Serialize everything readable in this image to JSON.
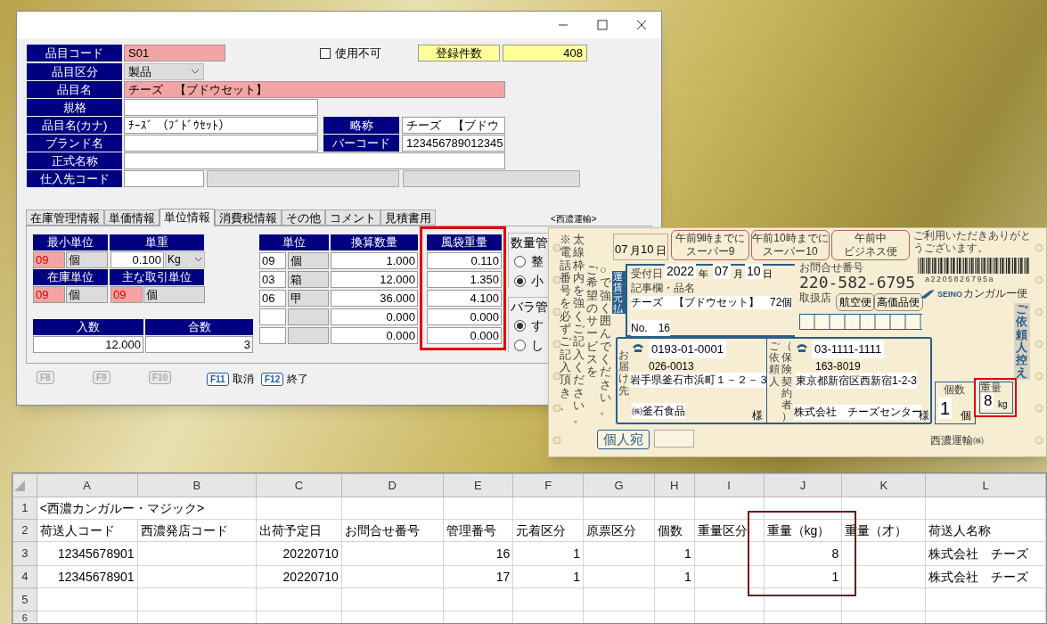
{
  "item_form": {
    "item_code": {
      "label": "品目コード",
      "value": "S01"
    },
    "unusable": {
      "label": "使用不可",
      "checked": false
    },
    "record_count": {
      "label": "登録件数",
      "value": "408"
    },
    "item_category": {
      "label": "品目区分",
      "value": "製品"
    },
    "item_name": {
      "label": "品目名",
      "value": "チーズ　【ブドウセット】"
    },
    "spec": {
      "label": "規格"
    },
    "item_name_kana": {
      "label": "品目名(カナ)",
      "value": "ﾁｰｽﾞ （ﾌﾞﾄﾞｳｾｯﾄ）"
    },
    "short_name": {
      "label": "略称",
      "value": "チーズ　【ブドウ"
    },
    "brand_name": {
      "label": "ブランド名"
    },
    "barcode": {
      "label": "バーコード",
      "value": "123456789012345"
    },
    "official_name": {
      "label": "正式名称"
    },
    "supplier_code": {
      "label": "仕入先コード"
    },
    "tabs": [
      {
        "label": "在庫管理情報",
        "selected": false
      },
      {
        "label": "単価情報",
        "selected": false
      },
      {
        "label": "単位情報",
        "selected": true
      },
      {
        "label": "消費税情報",
        "selected": false
      },
      {
        "label": "その他",
        "selected": false
      },
      {
        "label": "コメント",
        "selected": false
      },
      {
        "label": "見積書用",
        "selected": false
      }
    ],
    "unit_panel": {
      "min_unit": {
        "label": "最小単位",
        "code": "09",
        "name": "個"
      },
      "unit_weight": {
        "label": "単重",
        "value": "0.100",
        "unit": "Kg"
      },
      "stock_unit": {
        "label": "在庫単位",
        "code": "09",
        "name": "個"
      },
      "main_unit": {
        "label": "主な取引単位",
        "code": "09",
        "name": "個"
      },
      "quantity_in": {
        "label": "入数",
        "value": "12.000"
      },
      "count": {
        "label": "合数",
        "value": "3"
      },
      "conversion_table": {
        "columns": [
          "単位",
          "換算数量",
          "風袋重量"
        ],
        "rows": [
          {
            "code": "09",
            "unit": "個",
            "quantity": "1.000",
            "tare_weight": "0.110"
          },
          {
            "code": "03",
            "unit": "箱",
            "quantity": "12.000",
            "tare_weight": "1.350"
          },
          {
            "code": "06",
            "unit": "甲",
            "quantity": "36.000",
            "tare_weight": "4.100"
          },
          {
            "quantity": "0.000",
            "tare_weight": "0.000"
          },
          {
            "quantity": "0.000",
            "tare_weight": "0.000"
          }
        ]
      }
    },
    "quantity_group": {
      "title": "数量管",
      "options": [
        {
          "label": "整",
          "selected": false
        },
        {
          "label": "小",
          "selected": true
        }
      ]
    },
    "bulk_group": {
      "title": "バラ管",
      "options": [
        {
          "label": "す",
          "selected": true
        },
        {
          "label": "し",
          "selected": false
        }
      ]
    },
    "function_keys": [
      {
        "key": "F8",
        "disabled": true
      },
      {
        "key": "F9",
        "disabled": true
      },
      {
        "key": "F10",
        "disabled": true
      },
      {
        "key": "F11",
        "label": "取消",
        "disabled": false
      },
      {
        "key": "F12",
        "label": "終了",
        "disabled": false
      }
    ]
  },
  "label_caption": "<西濃運輸>",
  "shipping_label": {
    "notes": [
      "※電話番号を必ずご記入頂き、",
      "太線枠内を強くご記入ください。",
      "ご希望のサービスを",
      "○で強く囲んでください。"
    ],
    "delivery_date": {
      "month": "07",
      "month_unit": "月",
      "day": "10",
      "day_unit": "日"
    },
    "services": [
      {
        "line1": "午前9時までに",
        "line2": "スーパー9"
      },
      {
        "line1": "午前10時までに",
        "line2": "スーパー10"
      },
      {
        "line1": "午前中",
        "line2": "ビジネス便"
      }
    ],
    "thanks": "ご利用いただきありがとうございます。",
    "barcode_digits": "a2205826795a",
    "reception": {
      "label": "受付日",
      "year": "2022",
      "year_unit": "年",
      "month": "07",
      "month_unit": "月",
      "day": "10",
      "day_unit": "日"
    },
    "freight": "運賃元払",
    "contents_label": "記事欄・品名",
    "contents": "チーズ　【ブドウセット】　72個",
    "number": "No.　16",
    "tracking_label": "お問合せ番号",
    "tracking_number": "220-582-6795",
    "handling_store": "取扱店",
    "options": [
      "航空便",
      "高価品便"
    ],
    "brand": {
      "mark": "SEINO",
      "service": "カンガルー便"
    },
    "copy_title": "ご依頼人控え",
    "recipient": {
      "heading": "お届け先",
      "phone": "0193-01-0001",
      "zip": "026-0013",
      "address": "岩手県釜石市浜町１－２－３",
      "name": "㈱釜石食品",
      "honorific": "様"
    },
    "sender_heading": [
      "ご依頼人",
      "（保険契約者）"
    ],
    "sender": {
      "phone": "03-1111-1111",
      "zip": "163-8019",
      "address": "東京都新宿区西新宿1-2-3",
      "name": "株式会社　チーズセンター",
      "honorific": "様"
    },
    "pieces": {
      "label": "個数",
      "value": "1",
      "unit": "個"
    },
    "weight": {
      "label": "重量",
      "value": "8",
      "unit": "kg"
    },
    "personal": "個人宛",
    "carrier": "西濃運輸㈱"
  },
  "spreadsheet": {
    "columns": [
      "A",
      "B",
      "C",
      "D",
      "E",
      "F",
      "G",
      "H",
      "I",
      "J",
      "K",
      "L"
    ],
    "rows": [
      {
        "number": "1",
        "kind": "title",
        "cells": [
          "<西濃カンガルー・マジック>"
        ]
      },
      {
        "number": "2",
        "kind": "header",
        "cells": [
          "荷送人コード",
          "西濃発店コード",
          "出荷予定日",
          "お問合せ番号",
          "管理番号",
          "元着区分",
          "原票区分",
          "個数",
          "重量区分",
          "重量（kg）",
          "重量（才）",
          "荷送人名称"
        ]
      },
      {
        "number": "3",
        "kind": "data",
        "cells": [
          "12345678901",
          null,
          "20220710",
          null,
          "16",
          "1",
          null,
          "1",
          null,
          "8",
          null,
          "株式会社　チーズ"
        ]
      },
      {
        "number": "4",
        "kind": "data",
        "cells": [
          "12345678901",
          null,
          "20220710",
          null,
          "17",
          "1",
          null,
          "1",
          null,
          "1",
          null,
          "株式会社　チーズ"
        ]
      },
      {
        "number": "5",
        "kind": "empty"
      },
      {
        "number": "6",
        "kind": "empty"
      }
    ]
  }
}
